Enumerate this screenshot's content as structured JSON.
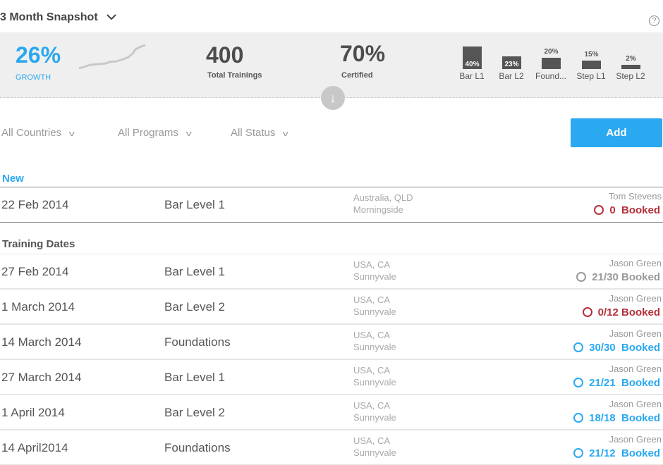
{
  "header": {
    "title": "3 Month Snapshot",
    "help": "?"
  },
  "stats": {
    "growth": "26%",
    "growth_label": "GROWTH",
    "total": "400",
    "total_label": "Total Trainings",
    "certified": "70%",
    "certified_label": "Certified",
    "bars": [
      {
        "pct": "40%",
        "label": "Bar L1",
        "value": 40
      },
      {
        "pct": "23%",
        "label": "Bar L2",
        "value": 23
      },
      {
        "pct": "20%",
        "label": "Found...",
        "value": 20
      },
      {
        "pct": "15%",
        "label": "Step L1",
        "value": 15
      },
      {
        "pct": "2%",
        "label": "Step L2",
        "value": 2
      }
    ]
  },
  "filters": {
    "country": "All Countries",
    "program": "All Programs",
    "status": "All Status",
    "add": "Add"
  },
  "colors": {
    "accent": "#2aa8f0",
    "alert": "#b5303a",
    "muted": "#999999"
  },
  "new_section": {
    "heading": "New",
    "rows": [
      {
        "date": "22 Feb 2014",
        "program": "Bar Level 1",
        "loc1": "Australia, QLD",
        "loc2": "Morningside",
        "person": "Tom Stevens",
        "booked": "0  Booked",
        "status": "alert"
      }
    ]
  },
  "dates_section": {
    "heading": "Training Dates",
    "rows": [
      {
        "date": "27 Feb 2014",
        "program": "Bar Level 1",
        "loc1": "USA, CA",
        "loc2": "Sunnyvale",
        "person": "Jason Green",
        "booked": "21/30 Booked",
        "status": "muted"
      },
      {
        "date": "1 March 2014",
        "program": "Bar Level 2",
        "loc1": "USA, CA",
        "loc2": "Sunnyvale",
        "person": "Jason Green",
        "booked": "0/12 Booked",
        "status": "alert"
      },
      {
        "date": "14 March 2014",
        "program": "Foundations",
        "loc1": "USA, CA",
        "loc2": "Sunnyvale",
        "person": "Jason Green",
        "booked": "30/30  Booked",
        "status": "accent"
      },
      {
        "date": "27 March 2014",
        "program": "Bar Level 1",
        "loc1": "USA, CA",
        "loc2": "Sunnyvale",
        "person": "Jason Green",
        "booked": "21/21  Booked",
        "status": "accent"
      },
      {
        "date": "1 April 2014",
        "program": "Bar Level 2",
        "loc1": "USA, CA",
        "loc2": "Sunnyvale",
        "person": "Jason Green",
        "booked": "18/18  Booked",
        "status": "accent"
      },
      {
        "date": "14 April2014",
        "program": "Foundations",
        "loc1": "USA, CA",
        "loc2": "Sunnyvale",
        "person": "Jason Green",
        "booked": "21/12  Booked",
        "status": "accent"
      }
    ]
  }
}
